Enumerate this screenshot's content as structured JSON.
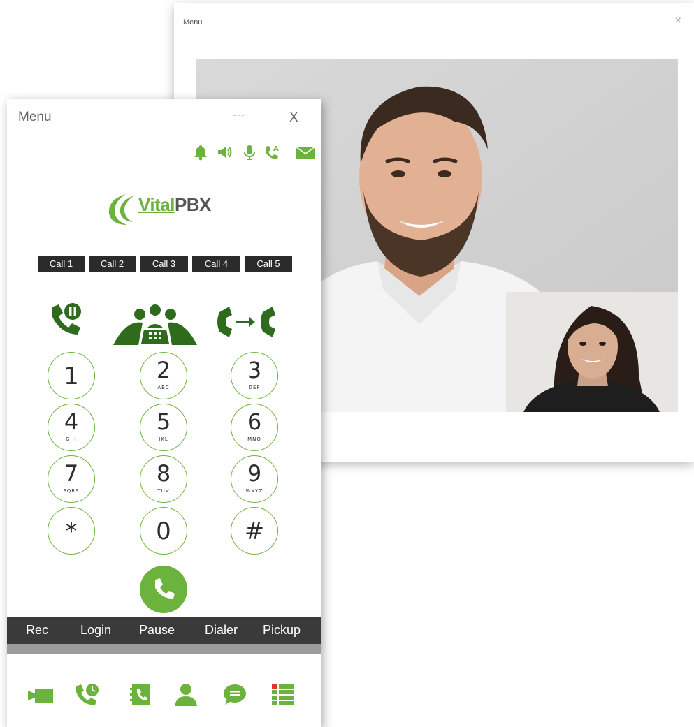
{
  "video_window": {
    "title": "Menu",
    "close_glyph": "×"
  },
  "phone": {
    "title": "Menu",
    "minimize_glyph": "---",
    "close_glyph": "X",
    "logo": {
      "vital": "Vital",
      "pbx": "PBX"
    },
    "call_tabs": [
      "Call 1",
      "Call 2",
      "Call 3",
      "Call 4",
      "Call 5"
    ],
    "keys": [
      {
        "digit": "1",
        "letters": ""
      },
      {
        "digit": "2",
        "letters": "ABC"
      },
      {
        "digit": "3",
        "letters": "DEF"
      },
      {
        "digit": "4",
        "letters": "GHI"
      },
      {
        "digit": "5",
        "letters": "JKL"
      },
      {
        "digit": "6",
        "letters": "MNO"
      },
      {
        "digit": "7",
        "letters": "PQRS"
      },
      {
        "digit": "8",
        "letters": "TUV"
      },
      {
        "digit": "9",
        "letters": "WXYZ"
      },
      {
        "digit": "*",
        "letters": ""
      },
      {
        "digit": "0",
        "letters": ""
      },
      {
        "digit": "#",
        "letters": ""
      }
    ],
    "actions": [
      "Rec",
      "Login",
      "Pause",
      "Dialer",
      "Pickup"
    ],
    "status_icons": [
      "bell-icon",
      "speaker-icon",
      "microphone-icon",
      "auto-answer-icon",
      "mail-icon"
    ],
    "feature_icons": [
      "hold-icon",
      "conference-icon",
      "transfer-icon"
    ],
    "bottom_icons": [
      "video-icon",
      "call-history-icon",
      "contacts-book-icon",
      "user-icon",
      "chat-icon",
      "list-icon"
    ]
  },
  "colors": {
    "accent_green": "#6cb33e",
    "dark_green": "#2e6b1c",
    "tab_dark": "#2b2b2b",
    "action_bar": "#3a3a3a",
    "gray_band": "#9b9b9b"
  }
}
